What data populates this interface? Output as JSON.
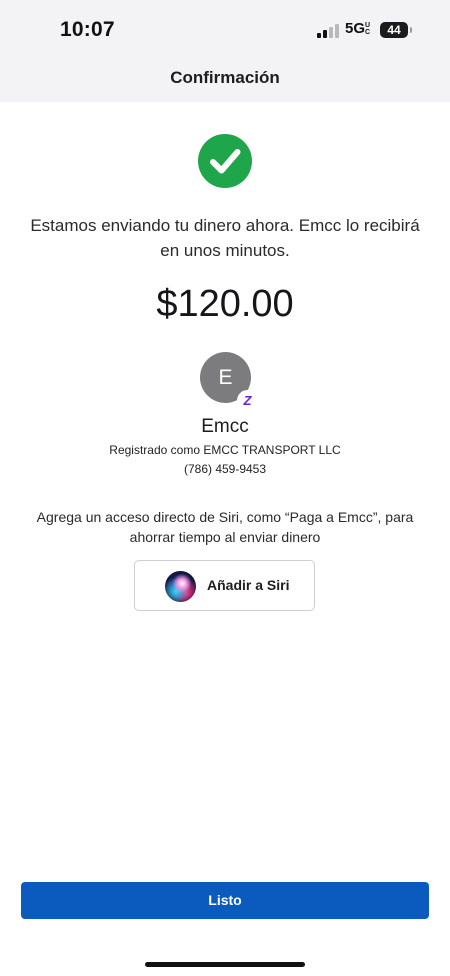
{
  "status_bar": {
    "time": "10:07",
    "network": "5G",
    "network_suffix": "UC",
    "battery": "44",
    "signal_bars_active": 2,
    "signal_bars_total": 4
  },
  "header": {
    "title": "Confirmación"
  },
  "confirmation": {
    "icon": "checkmark-circle-icon",
    "icon_color": "#1fa64a",
    "message": "Estamos enviando tu dinero ahora. Emcc lo recibirá en unos minutos.",
    "amount": "$120.00"
  },
  "recipient": {
    "initial": "E",
    "badge": "Z",
    "name": "Emcc",
    "registered_as": "Registrado como EMCC TRANSPORT LLC",
    "phone": "(786) 459-9453"
  },
  "siri": {
    "prompt": "Agrega un acceso directo de Siri, como “Paga a Emcc”, para ahorrar tiempo al enviar dinero",
    "button_label": "Añadir a Siri",
    "icon": "siri-orb-icon"
  },
  "footer": {
    "done_label": "Listo",
    "done_color": "#0b5bbf"
  }
}
